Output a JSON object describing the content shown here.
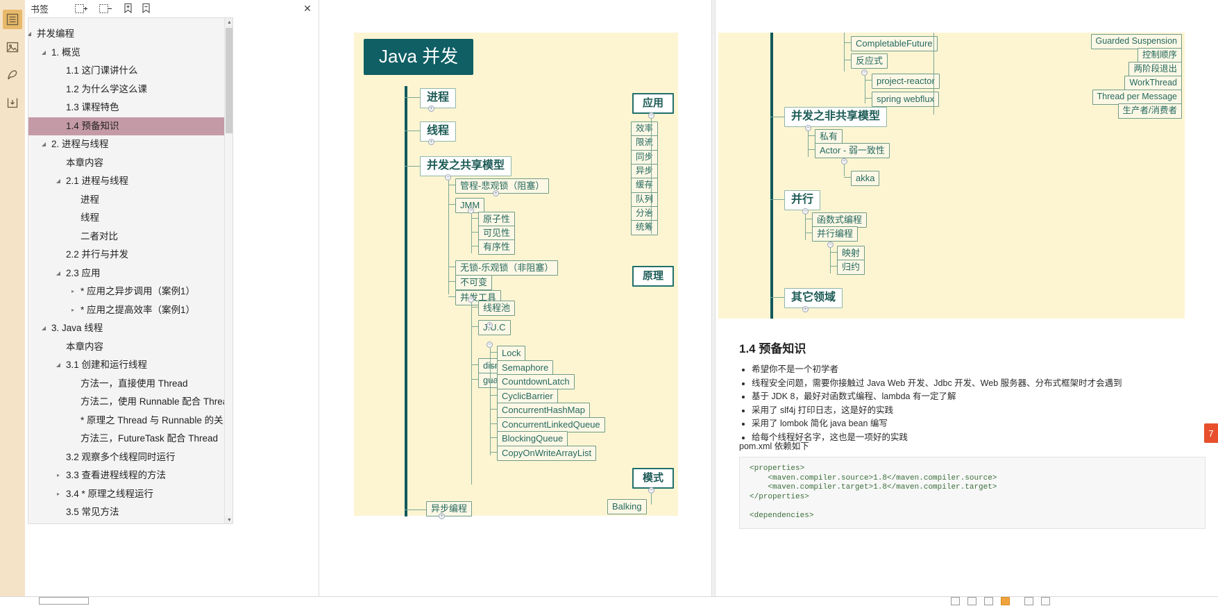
{
  "rail": {
    "items": [
      {
        "name": "outline-icon",
        "glyph": "list",
        "active": true
      },
      {
        "name": "thumbnails-icon",
        "glyph": "image",
        "active": false
      },
      {
        "name": "annotate-icon",
        "glyph": "pen",
        "active": false
      },
      {
        "name": "export-icon",
        "glyph": "export",
        "active": false
      }
    ]
  },
  "outline": {
    "title": "书签",
    "toolbar": [
      {
        "name": "expand-all-button",
        "tip": "展开全部"
      },
      {
        "name": "collapse-all-button",
        "tip": "折叠全部"
      },
      {
        "name": "add-bookmark-button",
        "tip": "添加书签"
      },
      {
        "name": "remove-bookmark-button",
        "tip": "删除书签"
      }
    ],
    "close_label": "✕",
    "scroll": {
      "up": "▲",
      "down": "▼"
    },
    "tree": [
      {
        "label": "并发编程",
        "indent": 0,
        "twist": "open",
        "selected": false
      },
      {
        "label": "1. 概览",
        "indent": 1,
        "twist": "open",
        "selected": false
      },
      {
        "label": "1.1 这门课讲什么",
        "indent": 2,
        "twist": "none",
        "selected": false
      },
      {
        "label": "1.2 为什么学这么课",
        "indent": 2,
        "twist": "none",
        "selected": false
      },
      {
        "label": "1.3 课程特色",
        "indent": 2,
        "twist": "none",
        "selected": false
      },
      {
        "label": "1.4 预备知识",
        "indent": 2,
        "twist": "none",
        "selected": true
      },
      {
        "label": "2. 进程与线程",
        "indent": 1,
        "twist": "open",
        "selected": false
      },
      {
        "label": "本章内容",
        "indent": 2,
        "twist": "none",
        "selected": false
      },
      {
        "label": "2.1 进程与线程",
        "indent": 2,
        "twist": "open",
        "selected": false
      },
      {
        "label": "进程",
        "indent": 3,
        "twist": "none",
        "selected": false
      },
      {
        "label": "线程",
        "indent": 3,
        "twist": "none",
        "selected": false
      },
      {
        "label": "二者对比",
        "indent": 3,
        "twist": "none",
        "selected": false
      },
      {
        "label": "2.2 并行与并发",
        "indent": 2,
        "twist": "none",
        "selected": false
      },
      {
        "label": "2.3 应用",
        "indent": 2,
        "twist": "open",
        "selected": false
      },
      {
        "label": "* 应用之异步调用（案例1）",
        "indent": 3,
        "twist": "closed",
        "selected": false
      },
      {
        "label": "* 应用之提高效率（案例1）",
        "indent": 3,
        "twist": "closed",
        "selected": false
      },
      {
        "label": "3. Java 线程",
        "indent": 1,
        "twist": "open",
        "selected": false
      },
      {
        "label": "本章内容",
        "indent": 2,
        "twist": "none",
        "selected": false
      },
      {
        "label": "3.1 创建和运行线程",
        "indent": 2,
        "twist": "open",
        "selected": false
      },
      {
        "label": "方法一，直接使用 Thread",
        "indent": 3,
        "twist": "none",
        "selected": false
      },
      {
        "label": "方法二，使用 Runnable 配合 Thread",
        "indent": 3,
        "twist": "none",
        "selected": false
      },
      {
        "label": "* 原理之 Thread 与 Runnable 的关系",
        "indent": 3,
        "twist": "none",
        "selected": false
      },
      {
        "label": "方法三，FutureTask 配合 Thread",
        "indent": 3,
        "twist": "none",
        "selected": false
      },
      {
        "label": "3.2 观察多个线程同时运行",
        "indent": 2,
        "twist": "none",
        "selected": false
      },
      {
        "label": "3.3 查看进程线程的方法",
        "indent": 2,
        "twist": "closed",
        "selected": false
      },
      {
        "label": "3.4 * 原理之线程运行",
        "indent": 2,
        "twist": "closed",
        "selected": false
      },
      {
        "label": "3.5 常见方法",
        "indent": 2,
        "twist": "none",
        "selected": false
      }
    ]
  },
  "mindmap_left": {
    "root": "Java 并发",
    "branch_process": "进程",
    "branch_thread": "线程",
    "branch_shared": "并发之共享模型",
    "shared_children": [
      "管程-悲观锁（阻塞）",
      "JMM",
      "无锁-乐观锁（非阻塞）",
      "不可变",
      "并发工具"
    ],
    "jmm_children": [
      "原子性",
      "可见性",
      "有序性"
    ],
    "tools_children": [
      "线程池",
      "J.U.C",
      "disruptor",
      "guava"
    ],
    "juc_children": [
      "Lock",
      "Semaphore",
      "CountdownLatch",
      "CyclicBarrier",
      "ConcurrentHashMap",
      "ConcurrentLinkedQueue",
      "BlockingQueue",
      "CopyOnWriteArrayList"
    ],
    "branch_async": "异步编程",
    "col_apply": "应用",
    "apply_children": [
      "效率",
      "限流",
      "同步",
      "异步",
      "缓存",
      "队列",
      "分治",
      "统筹"
    ],
    "col_principle": "原理",
    "col_pattern": "模式",
    "pattern_first": "Balking"
  },
  "mindmap_right": {
    "async_children": [
      "CompletableFuture",
      "反应式"
    ],
    "reactive_children": [
      "project-reactor",
      "spring webflux"
    ],
    "pattern_children": [
      "Guarded Suspension",
      "控制顺序",
      "两阶段退出",
      "WorkThread",
      "Thread per Message",
      "生产者/消费者"
    ],
    "branch_nonshared": "并发之非共享模型",
    "nonshared_children": [
      "私有",
      "Actor - 弱一致性"
    ],
    "actor_children": [
      "akka"
    ],
    "branch_parallel": "并行",
    "parallel_children": [
      "函数式编程",
      "并行编程"
    ],
    "parallel_prog_children": [
      "映射",
      "归约"
    ],
    "branch_other": "其它领域"
  },
  "right_page": {
    "heading": "1.4 预备知识",
    "bullets": [
      "希望你不是一个初学者",
      "线程安全问题，需要你接触过 Java Web 开发、Jdbc 开发、Web 服务器、分布式框架时才会遇到",
      "基于 JDK 8，最好对函数式编程、lambda 有一定了解",
      "采用了 slf4j 打印日志，这是好的实践",
      "采用了 lombok 简化 java bean 编写",
      "给每个线程好名字，这也是一项好的实践"
    ],
    "pom_note": "pom.xml 依赖如下",
    "code_lines": [
      "<properties>",
      "    <maven.compiler.source>1.8</maven.compiler.source>",
      "    <maven.compiler.target>1.8</maven.compiler.target>",
      "</properties>",
      "",
      "<dependencies>"
    ]
  },
  "side_badge": {
    "label": "7"
  },
  "colors": {
    "rail_bg": "#f5e3c8",
    "rail_active": "#e7b96a",
    "selection": "#c49aa6",
    "mindmap_bg": "#fdf5d2",
    "node_border": "#6f9b84",
    "node_text": "#24695e",
    "root_bg": "#0f5f64",
    "trunk": "#10595c",
    "badge": "#e8502d",
    "code_text": "#3b6e3b"
  }
}
